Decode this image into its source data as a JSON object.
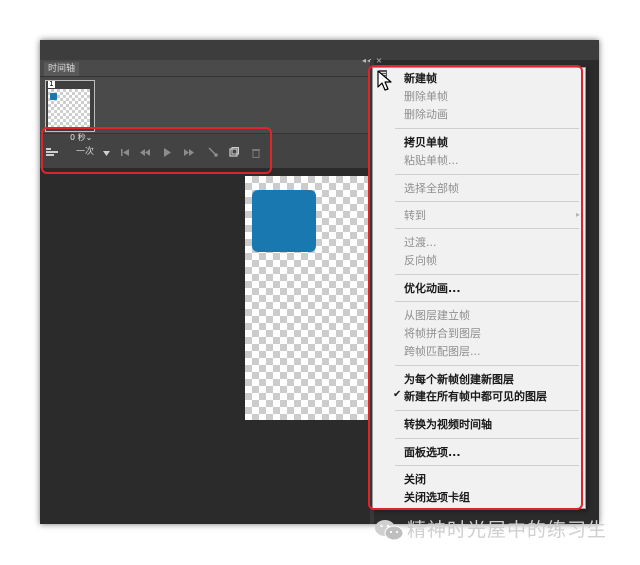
{
  "timeline_panel": {
    "tab_label": "时间轴",
    "dock_controls": "◂◂ ×",
    "frame_number": "1",
    "frame_delay": "0 秒⌄",
    "controls": {
      "convert_icon": "convert-to-video-icon",
      "loop_label": "一次",
      "loop_dropdown_icon": "triangle-down-icon",
      "first_frame_icon": "first-frame-icon",
      "prev_frame_icon": "previous-frame-icon",
      "play_icon": "play-icon",
      "next_frame_icon": "next-frame-icon",
      "tween_icon": "tween-icon",
      "new_frame_icon": "duplicate-frame-icon",
      "delete_icon": "trash-icon"
    }
  },
  "context_menu": {
    "items": [
      {
        "label": "新建帧",
        "enabled": true
      },
      {
        "label": "删除单帧",
        "enabled": false
      },
      {
        "label": "删除动画",
        "enabled": false
      },
      {
        "label": "拷贝单帧",
        "enabled": true
      },
      {
        "label": "粘贴单帧...",
        "enabled": false
      },
      {
        "label": "选择全部帧",
        "enabled": false
      },
      {
        "label": "转到",
        "enabled": false
      },
      {
        "label": "过渡...",
        "enabled": false
      },
      {
        "label": "反向帧",
        "enabled": false
      },
      {
        "label": "优化动画...",
        "enabled": true
      },
      {
        "label": "从图层建立帧",
        "enabled": false
      },
      {
        "label": "将帧拼合到图层",
        "enabled": false
      },
      {
        "label": "跨帧匹配图层...",
        "enabled": false
      },
      {
        "label": "为每个新帧创建新图层",
        "enabled": true
      },
      {
        "label": "新建在所有帧中都可见的图层",
        "enabled": true,
        "checked": true
      },
      {
        "label": "转换为视频时间轴",
        "enabled": true
      },
      {
        "label": "面板选项...",
        "enabled": true
      },
      {
        "label": "关闭",
        "enabled": true
      },
      {
        "label": "关闭选项卡组",
        "enabled": true
      }
    ],
    "check_glyph": "✔",
    "submenu_glyph": "▸"
  },
  "watermark": {
    "icon": "wechat-icon",
    "text": "精神时光屋中的练习生"
  },
  "colors": {
    "highlight": "#e0242b",
    "shape_blue": "#1a78b1",
    "panel_dark": "#2b2b2b",
    "menu_bg": "#f1f1f1"
  }
}
